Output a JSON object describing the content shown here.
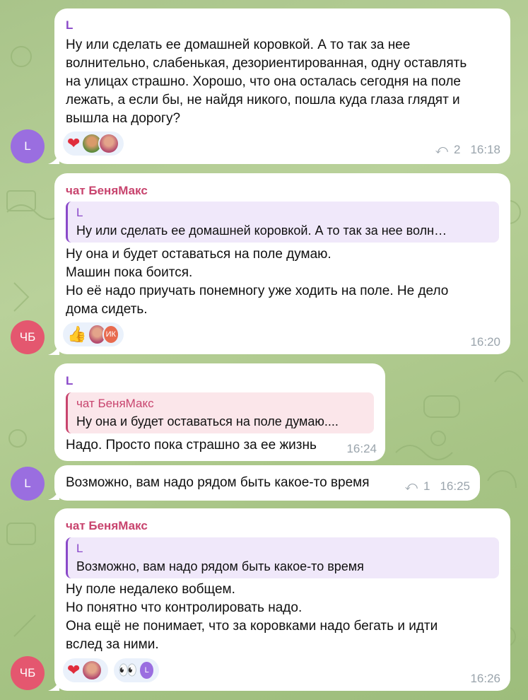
{
  "colors": {
    "L_name": "#8a49c9",
    "CB_name": "#c8446e",
    "L_avatar": "#9a6ee0",
    "CB_avatar": "#e4576f",
    "reply_L_bg": "#f0e8fa",
    "reply_CB_bg": "#fbe6ea"
  },
  "messages": [
    {
      "sender": "L",
      "lines": [
        "Ну или сделать ее домашней коровкой. А то так за нее",
        "волнительно, слабенькая, дезориентированная, одну оставлять",
        "на улицах страшно. Хорошо, что она осталась сегодня на поле",
        "лежать, а если бы, не найдя никого, пошла куда глаза глядят и",
        "вышла на дорогу?"
      ],
      "reactions": [
        "heart-emoji",
        "avatar-a",
        "avatar-b"
      ],
      "reply_count": "2",
      "time": "16:18",
      "avatar_initial": "L"
    },
    {
      "sender": "чат БеняМакс",
      "reply_to": {
        "name": "L",
        "text": "Ну или сделать ее домашней коровкой. А то так за нее волн…"
      },
      "lines": [
        "Ну она и будет оставаться на поле думаю.",
        "Машин пока боится.",
        "Но её надо приучать понемногу уже ходить на поле. Не дело",
        "дома сидеть."
      ],
      "reactions": [
        "thumbs-up-emoji",
        "avatar-b",
        "ИК"
      ],
      "time": "16:20",
      "avatar_initial": "ЧБ"
    },
    {
      "sender": "L",
      "reply_to": {
        "name": "чат БеняМакс",
        "text": "Ну она и будет оставаться на поле думаю...."
      },
      "lines": [
        "Надо. Просто пока страшно за ее жизнь"
      ],
      "time": "16:24"
    },
    {
      "lines": [
        "Возможно, вам надо рядом быть какое-то время"
      ],
      "reply_count": "1",
      "time": "16:25",
      "avatar_initial": "L"
    },
    {
      "sender": "чат БеняМакс",
      "reply_to": {
        "name": "L",
        "text": "Возможно, вам надо рядом быть какое-то время"
      },
      "lines": [
        "Ну поле недалеко вобщем.",
        "Но понятно что контролировать надо.",
        "Она ещё не понимает, что за коровками надо бегать и идти",
        "вслед за ними."
      ],
      "reactions": [
        "heart-emoji",
        "avatar-b",
        "eyes-emoji",
        "L"
      ],
      "time": "16:26",
      "avatar_initial": "ЧБ"
    }
  ]
}
